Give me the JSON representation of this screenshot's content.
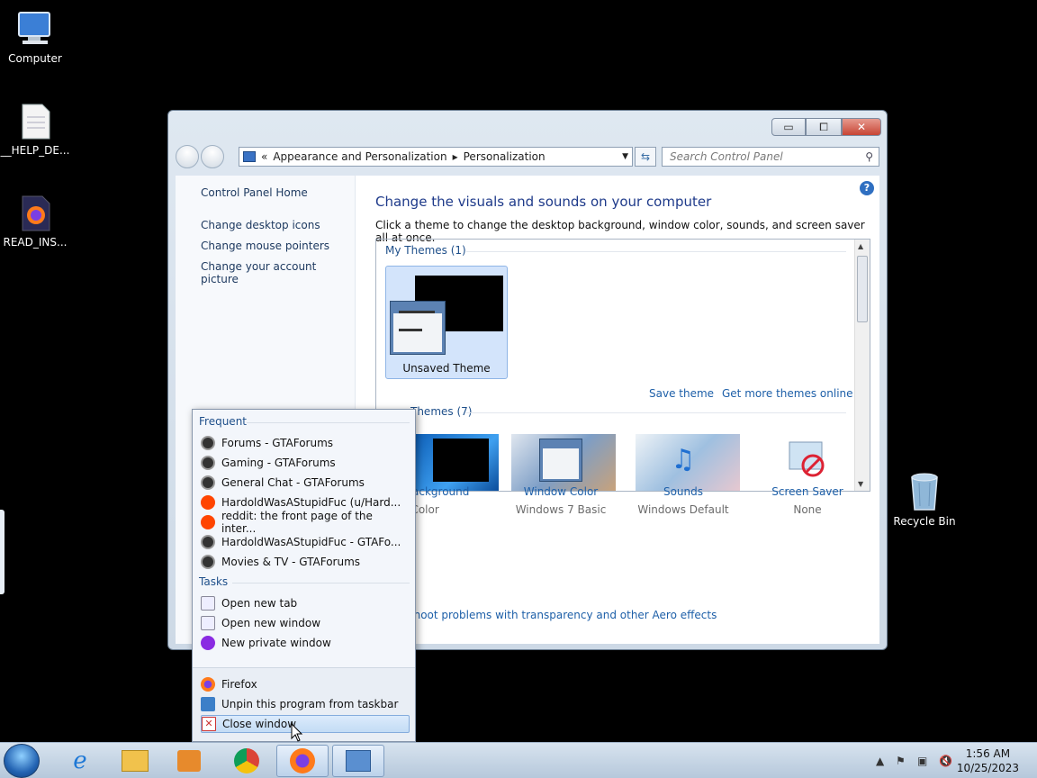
{
  "desktop": {
    "icons": [
      {
        "label": "Computer"
      },
      {
        "label": "__HELP_DE..."
      },
      {
        "label": "READ_INS..."
      },
      {
        "label": "Recycle Bin"
      }
    ]
  },
  "window": {
    "caption_buttons": {
      "minimize": "▭",
      "maximize": "⧠",
      "close": "✕"
    },
    "address": {
      "chevron": "«",
      "segments": [
        "Appearance and Personalization",
        "Personalization"
      ]
    },
    "search_placeholder": "Search Control Panel",
    "left_links": [
      "Control Panel Home",
      "Change desktop icons",
      "Change mouse pointers",
      "Change your account picture"
    ],
    "heading": "Change the visuals and sounds on your computer",
    "subheading": "Click a theme to change the desktop background, window color, sounds, and screen saver all at once.",
    "my_themes_label": "My Themes (1)",
    "theme_tile_label": "Unsaved Theme",
    "save_theme": "Save theme",
    "more_themes": "Get more themes online",
    "aero_themes_label": "Themes (7)",
    "bottom": [
      {
        "title": "op Background",
        "subtitle": "olid Color"
      },
      {
        "title": "Window Color",
        "subtitle": "Windows 7 Basic"
      },
      {
        "title": "Sounds",
        "subtitle": "Windows Default"
      },
      {
        "title": "Screen Saver",
        "subtitle": "None"
      }
    ],
    "troubleshoot": "bleshoot problems with transparency and other Aero effects"
  },
  "jumplist": {
    "frequent_header": "Frequent",
    "frequent": [
      "Forums - GTAForums",
      "Gaming - GTAForums",
      "General Chat - GTAForums",
      "HardoldWasAStupidFuc (u/Hard...",
      "reddit: the front page of the inter...",
      "HardoldWasAStupidFuc - GTAFo...",
      "Movies & TV - GTAForums"
    ],
    "tasks_header": "Tasks",
    "tasks": [
      "Open new tab",
      "Open new window",
      "New private window"
    ],
    "footer": [
      "Firefox",
      "Unpin this program from taskbar",
      "Close window"
    ]
  },
  "taskbar": {
    "time": "1:56 AM",
    "date": "10/25/2023"
  }
}
